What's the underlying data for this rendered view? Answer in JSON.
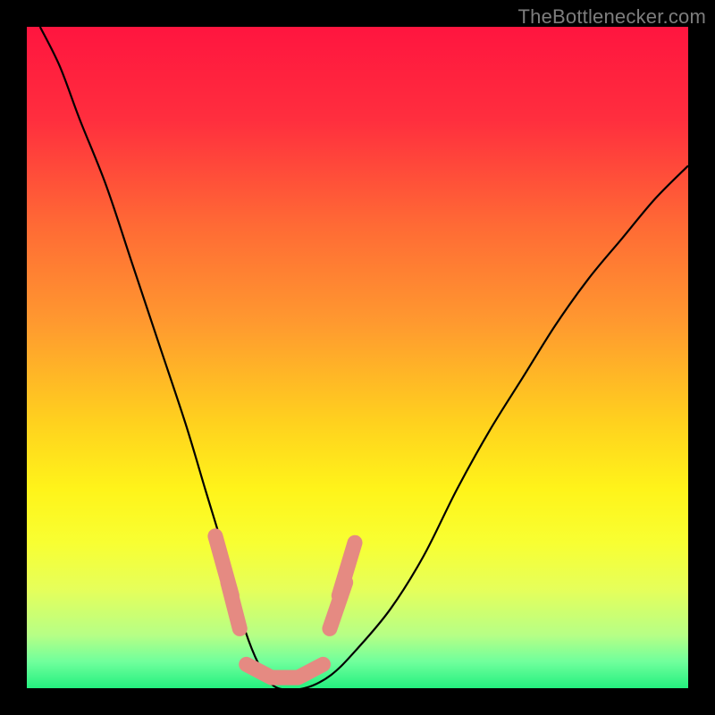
{
  "watermark": "TheBottlenecker.com",
  "chart_data": {
    "type": "line",
    "title": "",
    "xlabel": "",
    "ylabel": "",
    "xlim": [
      0,
      100
    ],
    "ylim": [
      0,
      100
    ],
    "gradient_stops": [
      {
        "offset": 0,
        "color": "#ff153f"
      },
      {
        "offset": 14,
        "color": "#ff2e3e"
      },
      {
        "offset": 30,
        "color": "#ff6a35"
      },
      {
        "offset": 45,
        "color": "#ff9a2f"
      },
      {
        "offset": 60,
        "color": "#ffd21e"
      },
      {
        "offset": 70,
        "color": "#fff41a"
      },
      {
        "offset": 78,
        "color": "#f8ff32"
      },
      {
        "offset": 85,
        "color": "#e6ff5a"
      },
      {
        "offset": 92,
        "color": "#b6ff86"
      },
      {
        "offset": 96,
        "color": "#70ff9c"
      },
      {
        "offset": 100,
        "color": "#24f07f"
      }
    ],
    "series": [
      {
        "name": "bottleneck-curve",
        "x": [
          2,
          5,
          8,
          12,
          16,
          20,
          24,
          27,
          30,
          32,
          34,
          36,
          38,
          42,
          46,
          50,
          55,
          60,
          65,
          70,
          75,
          80,
          85,
          90,
          95,
          100
        ],
        "y": [
          100,
          94,
          86,
          76,
          64,
          52,
          40,
          30,
          20,
          12,
          6,
          2,
          0,
          0,
          2,
          6,
          12,
          20,
          30,
          39,
          47,
          55,
          62,
          68,
          74,
          79
        ]
      }
    ],
    "worm": {
      "color": "#e58a82",
      "stroke_width": 17,
      "segments": [
        {
          "x": [
            28.5,
            31.0
          ],
          "y": [
            23.0,
            14.0
          ]
        },
        {
          "x": [
            30.4,
            32.2
          ],
          "y": [
            16.0,
            9.0
          ]
        },
        {
          "x": [
            33.2,
            37.0,
            41.0,
            44.8
          ],
          "y": [
            3.6,
            1.6,
            1.6,
            3.6
          ]
        },
        {
          "x": [
            45.8,
            48.2
          ],
          "y": [
            9.0,
            16.0
          ]
        },
        {
          "x": [
            47.2,
            49.6
          ],
          "y": [
            14.0,
            22.0
          ]
        }
      ]
    }
  }
}
